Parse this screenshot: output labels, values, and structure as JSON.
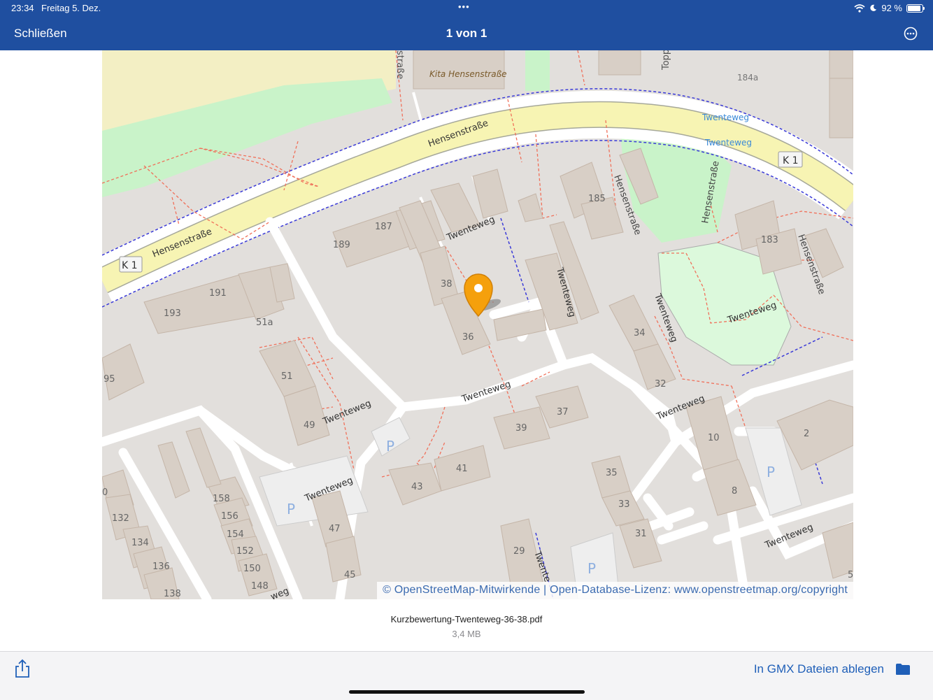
{
  "status_bar": {
    "time": "23:34",
    "date": "Freitag 5. Dez.",
    "battery": "92 %",
    "battery_level": 0.92
  },
  "nav": {
    "close_label": "Schließen",
    "title": "1 von 1",
    "more_icon": "ellipsis-circle-icon"
  },
  "map": {
    "copyright": "© OpenStreetMap-Mitwirkende | Open-Database-Lizenz: www.openstreetmap.org/copyright",
    "labels": {
      "strasse_top": "straße",
      "kita": "Kita Hensenstraße",
      "topp": "Topp",
      "n184a": "184a",
      "stop1": "Twenteweg",
      "stop2": "Twenteweg",
      "k1_right": "K 1",
      "hensen_road_upper": "Hensenstraße",
      "hensen_road_lower": "Hensenstraße",
      "k1_left": "K 1",
      "n189": "189",
      "n187": "187",
      "twente_a": "Twenteweg",
      "n185": "185",
      "hensen_v1": "Hensenstraße",
      "hensen_v2": "Hensenstraße",
      "n183": "183",
      "hensen_v3": "Hensenstraße",
      "n191": "191",
      "n193": "193",
      "n51a": "51a",
      "n38": "38",
      "n36": "36",
      "twente_v1": "Twenteweg",
      "n34": "34",
      "twente_v2": "Twenteweg",
      "twente_park": "Twenteweg",
      "n95": "95",
      "n51": "51",
      "twente_b": "Twenteweg",
      "n49": "49",
      "twente_c": "Twenteweg",
      "n32": "32",
      "n37": "37",
      "n39": "39",
      "twente_d": "Twenteweg",
      "n10": "10",
      "n2": "2",
      "n41": "41",
      "n43": "43",
      "n0": "0",
      "n158": "158",
      "n156": "156",
      "n154": "154",
      "n152": "152",
      "n150": "150",
      "n148": "148",
      "n132": "132",
      "n134": "134",
      "n136": "136",
      "n138": "138",
      "twente_e": "Twenteweg",
      "n47": "47",
      "n45": "45",
      "n35": "35",
      "n33": "33",
      "n31": "31",
      "n8": "8",
      "n29": "29",
      "twente_f": "Twenteweg",
      "twente_g": "Twente",
      "weg_bl": "weg",
      "n5": "5",
      "parking": "P"
    }
  },
  "file": {
    "name": "Kurzbewertung-Twenteweg-36-38.pdf",
    "size": "3,4 MB"
  },
  "bottom_bar": {
    "share_icon": "share-icon",
    "save_label": "In GMX Dateien ablegen",
    "folder_icon": "folder-icon"
  },
  "colors": {
    "bar_blue": "#1f4fa0",
    "accent_blue": "#1f5fb8",
    "pin_orange": "#f5a00c"
  }
}
